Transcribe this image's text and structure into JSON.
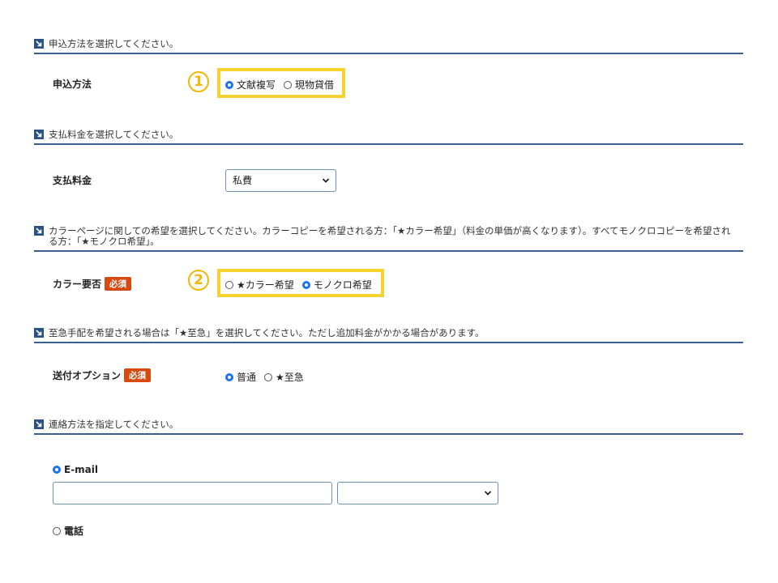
{
  "colors": {
    "header_line": "#3a5f8f",
    "header_icon": "#2c5282",
    "required_badge": "#d9480f",
    "highlight": "#f5d230",
    "radio_checked": "#1a73e8"
  },
  "sections": {
    "method": {
      "header": "申込方法を選択してください。",
      "label": "申込方法",
      "callout": "1",
      "options": [
        "文献複写",
        "現物貸借"
      ],
      "selected": "文献複写"
    },
    "payment": {
      "header": "支払料金を選択してください。",
      "label": "支払料金",
      "selected_value": "私費"
    },
    "color": {
      "header": "カラーページに関しての希望を選択してください。カラーコピーを希望される方：「★カラー希望」（料金の単価が高くなります）。すべてモノクロコピーを希望される方：「★モノクロ希望」。",
      "label": "カラー要否",
      "required": "必須",
      "callout": "2",
      "options": [
        "★カラー希望",
        "モノクロ希望"
      ],
      "selected": "モノクロ希望"
    },
    "delivery": {
      "header": "至急手配を希望される場合は「★至急」を選択してください。ただし追加料金がかかる場合があります。",
      "label": "送付オプション",
      "required": "必須",
      "options": [
        "普通",
        "★至急"
      ],
      "selected": "普通"
    },
    "contact": {
      "header": "連絡方法を指定してください。",
      "email_label": "E-mail",
      "email_value": "",
      "domain_value": "",
      "phone_label": "電話",
      "selected": "E-mail"
    }
  }
}
